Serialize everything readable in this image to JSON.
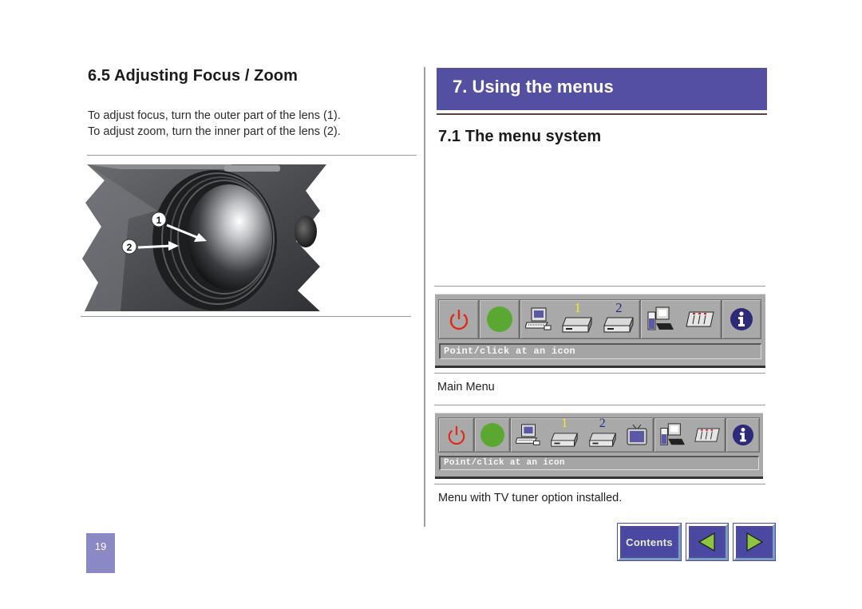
{
  "left": {
    "heading": "6.5  Adjusting Focus / Zoom",
    "paragraph_lines": [
      "To adjust focus, turn the outer part of the lens (1).",
      "To adjust zoom, turn the inner part of the lens (2)."
    ],
    "figure": {
      "description": "Projector lens illustration",
      "callouts": [
        "1",
        "2"
      ]
    }
  },
  "right": {
    "chapter_title": "7. Using the menus",
    "section_heading": "7.1  The menu system",
    "menus": [
      {
        "name": "main-menu",
        "icons": [
          "power-icon",
          "green-circle-icon",
          "computer-icon",
          "video-source-1-icon",
          "video-source-2-icon",
          "network-computer-icon",
          "settings-panel-icon",
          "info-icon"
        ],
        "source_labels": [
          "1",
          "2"
        ],
        "status_text": "Point/click at an icon",
        "caption": "Main Menu"
      },
      {
        "name": "tv-tuner-menu",
        "icons": [
          "power-icon",
          "green-circle-icon",
          "computer-icon",
          "video-source-1-icon",
          "video-source-2-icon",
          "tv-icon",
          "network-computer-icon",
          "settings-panel-icon",
          "info-icon"
        ],
        "source_labels": [
          "1",
          "2"
        ],
        "status_text": "Point/click at an icon",
        "caption": "Menu with TV tuner option installed."
      }
    ]
  },
  "footer": {
    "page_number": "19",
    "contents_label": "Contents",
    "prev_icon": "prev-arrow-icon",
    "next_icon": "next-arrow-icon"
  },
  "colors": {
    "banner": "#5350a1",
    "nav_button": "#4d4b9f",
    "page_tab": "#8b88c6",
    "arrow_fill": "#8cc63f",
    "power_red": "#e02a1a",
    "status_green": "#5aa832",
    "info_blue": "#2d2a7a"
  }
}
